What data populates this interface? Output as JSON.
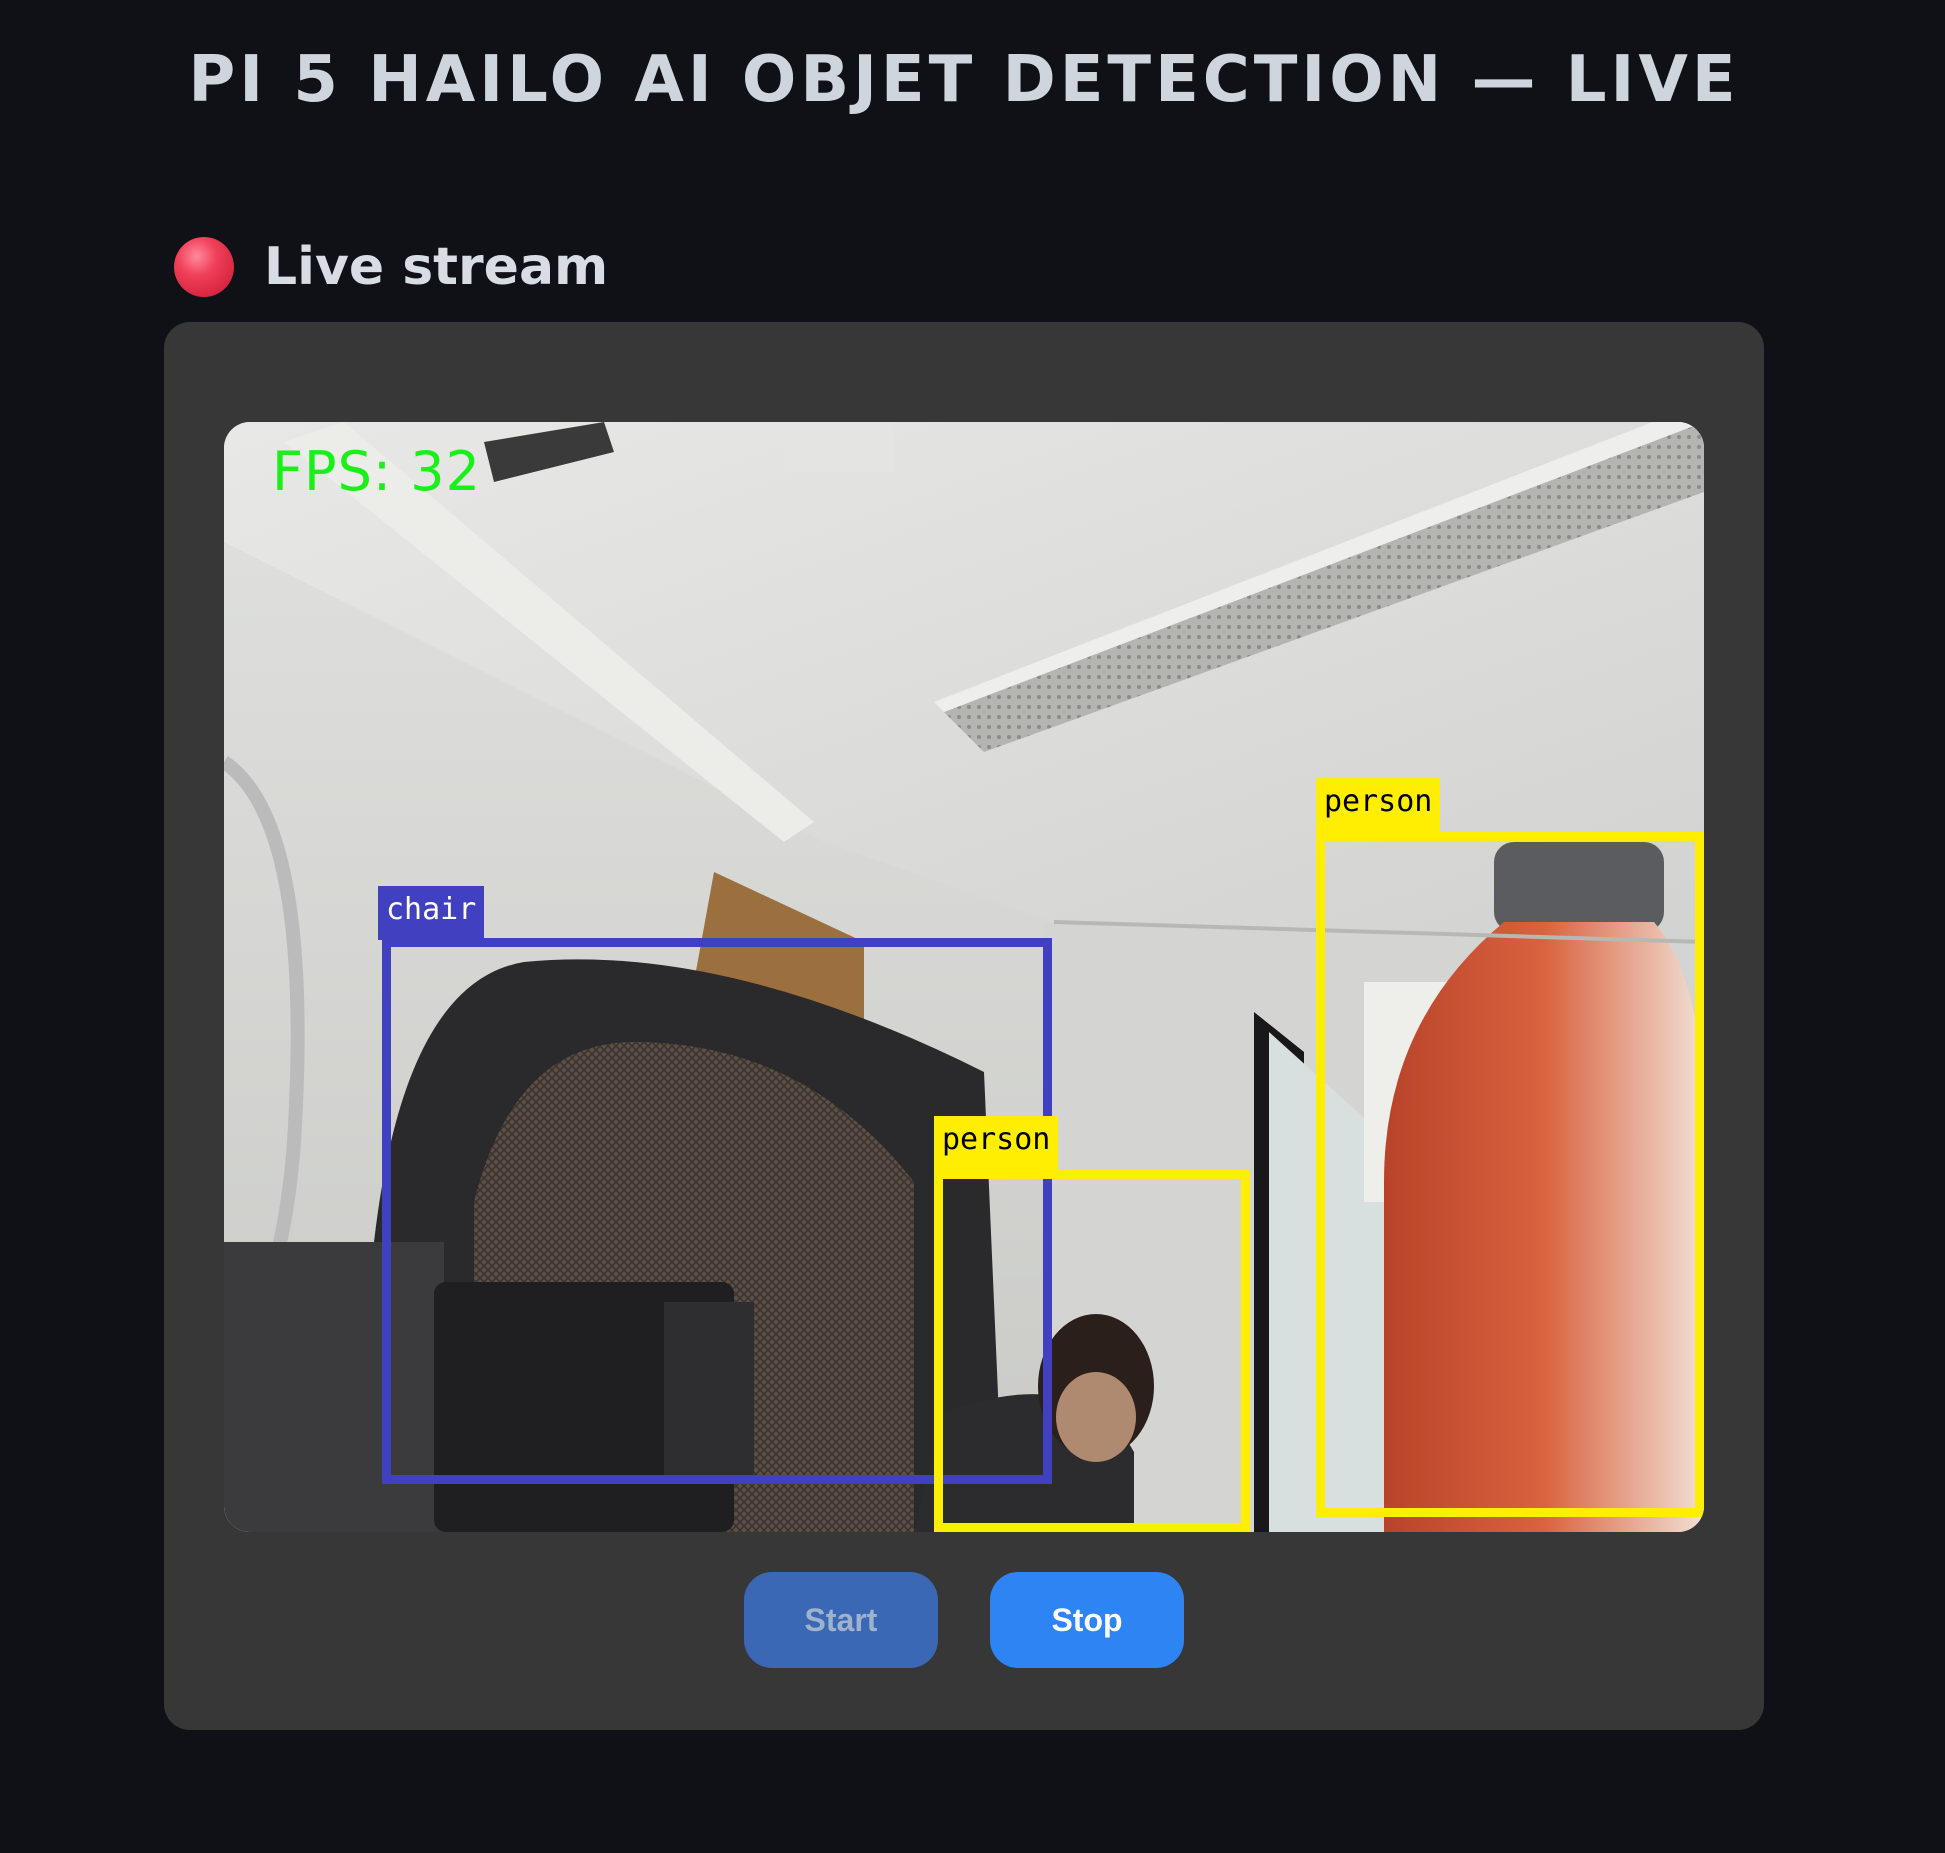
{
  "page": {
    "title": "PI 5 HAILO AI OBJET DETECTION — LIVE"
  },
  "stream_section": {
    "title": "Live stream",
    "status_icon": "red-dot-icon",
    "fps_text": "FPS: 32",
    "detections": [
      {
        "label": "chair",
        "color": "#4040c0"
      },
      {
        "label": "person",
        "color": "#ffee00"
      },
      {
        "label": "person",
        "color": "#ffee00"
      }
    ]
  },
  "controls": {
    "start_label": "Start",
    "stop_label": "Stop"
  }
}
